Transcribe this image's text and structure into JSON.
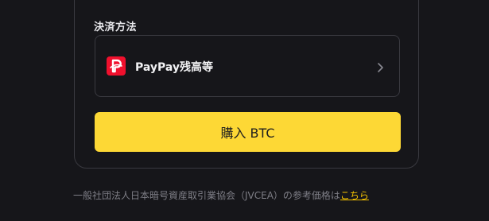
{
  "payment": {
    "section_label": "決済方法",
    "method_label": "PayPay残高等",
    "method_icon": "paypay-logo-icon",
    "brand_color": "#f0102d"
  },
  "action": {
    "buy_label": "購入 BTC",
    "button_color": "#fdd835"
  },
  "footer": {
    "note_text": "一般社団法人日本暗号資産取引業協会（JVCEA）の参考価格は",
    "link_text": "こちら",
    "link_color": "#f4c200"
  }
}
